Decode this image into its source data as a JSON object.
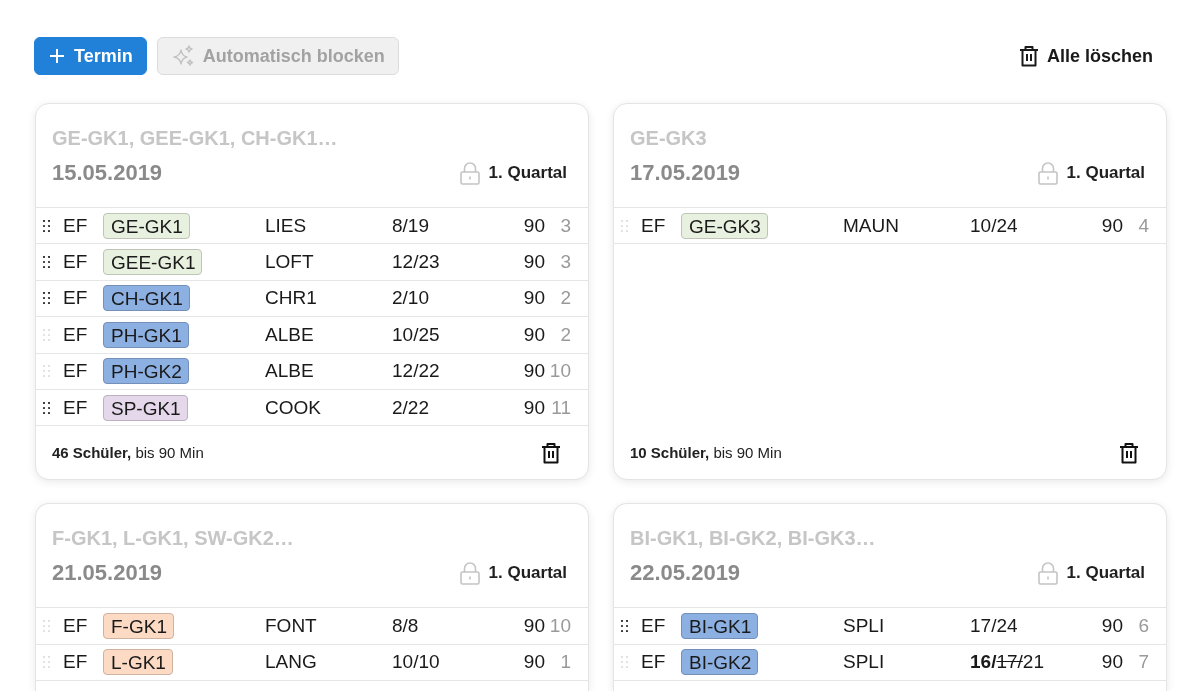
{
  "toolbar": {
    "buttons": [
      {
        "kind": "add",
        "label": "Termin",
        "disabled": false
      },
      {
        "kind": "auto",
        "label": "Automatisch blocken",
        "disabled": true
      }
    ],
    "clear_all": {
      "label": "Alle löschen"
    }
  },
  "cards": [
    {
      "title": "GE-GK1, GEE-GK1, CH-GK1…",
      "date": "15.05.2019",
      "period": "1. Quartal",
      "rows": [
        {
          "movable": true,
          "grade": "EF",
          "course": "GE-GK1",
          "color": "#e8f0df",
          "teacher": "LIES",
          "ratio": [
            {
              "kind": "plain",
              "text": "8/19"
            }
          ],
          "minutes": "90",
          "count": "3"
        },
        {
          "movable": true,
          "grade": "EF",
          "course": "GEE-GK1",
          "color": "#e8f0df",
          "teacher": "LOFT",
          "ratio": [
            {
              "kind": "plain",
              "text": "12/23"
            }
          ],
          "minutes": "90",
          "count": "3"
        },
        {
          "movable": true,
          "grade": "EF",
          "course": "CH-GK1",
          "color": "#8db0e2",
          "teacher": "CHR1",
          "ratio": [
            {
              "kind": "plain",
              "text": "2/10"
            }
          ],
          "minutes": "90",
          "count": "2"
        },
        {
          "movable": false,
          "grade": "EF",
          "course": "PH-GK1",
          "color": "#8db0e2",
          "teacher": "ALBE",
          "ratio": [
            {
              "kind": "plain",
              "text": "10/25"
            }
          ],
          "minutes": "90",
          "count": "2"
        },
        {
          "movable": false,
          "grade": "EF",
          "course": "PH-GK2",
          "color": "#8db0e2",
          "teacher": "ALBE",
          "ratio": [
            {
              "kind": "plain",
              "text": "12/22"
            }
          ],
          "minutes": "90",
          "count": "10"
        },
        {
          "movable": true,
          "grade": "EF",
          "course": "SP-GK1",
          "color": "#e5d8ea",
          "teacher": "COOK",
          "ratio": [
            {
              "kind": "plain",
              "text": "2/22"
            }
          ],
          "minutes": "90",
          "count": "11"
        }
      ],
      "footer": "**46 Schüler,** bis 90 Min"
    },
    {
      "title": "GE-GK3",
      "date": "17.05.2019",
      "period": "1. Quartal",
      "rows": [
        {
          "movable": false,
          "grade": "EF",
          "course": "GE-GK3",
          "color": "#e8f0df",
          "teacher": "MAUN",
          "ratio": [
            {
              "kind": "plain",
              "text": "10/24"
            }
          ],
          "minutes": "90",
          "count": "4"
        }
      ],
      "footer": "**10 Schüler,** bis 90 Min"
    },
    {
      "title": "F-GK1, L-GK1, SW-GK2…",
      "date": "21.05.2019",
      "period": "1. Quartal",
      "rows": [
        {
          "movable": false,
          "grade": "EF",
          "course": "F-GK1",
          "color": "#fcdac4",
          "teacher": "FONT",
          "ratio": [
            {
              "kind": "plain",
              "text": "8/8"
            }
          ],
          "minutes": "90",
          "count": "10"
        },
        {
          "movable": false,
          "grade": "EF",
          "course": "L-GK1",
          "color": "#fcdac4",
          "teacher": "LANG",
          "ratio": [
            {
              "kind": "plain",
              "text": "10/10"
            }
          ],
          "minutes": "90",
          "count": "1"
        }
      ]
    },
    {
      "title": "BI-GK1, BI-GK2, BI-GK3…",
      "date": "22.05.2019",
      "period": "1. Quartal",
      "rows": [
        {
          "movable": true,
          "grade": "EF",
          "course": "BI-GK1",
          "color": "#8db0e2",
          "teacher": "SPLI",
          "ratio": [
            {
              "kind": "plain",
              "text": "17/24"
            }
          ],
          "minutes": "90",
          "count": "6"
        },
        {
          "movable": false,
          "grade": "EF",
          "course": "BI-GK2",
          "color": "#8db0e2",
          "teacher": "SPLI",
          "ratio": [
            {
              "kind": "bold",
              "text": "16/"
            },
            {
              "kind": "struck",
              "text": "17/"
            },
            {
              "kind": "plain",
              "text": "21"
            }
          ],
          "minutes": "90",
          "count": "7"
        }
      ]
    }
  ]
}
